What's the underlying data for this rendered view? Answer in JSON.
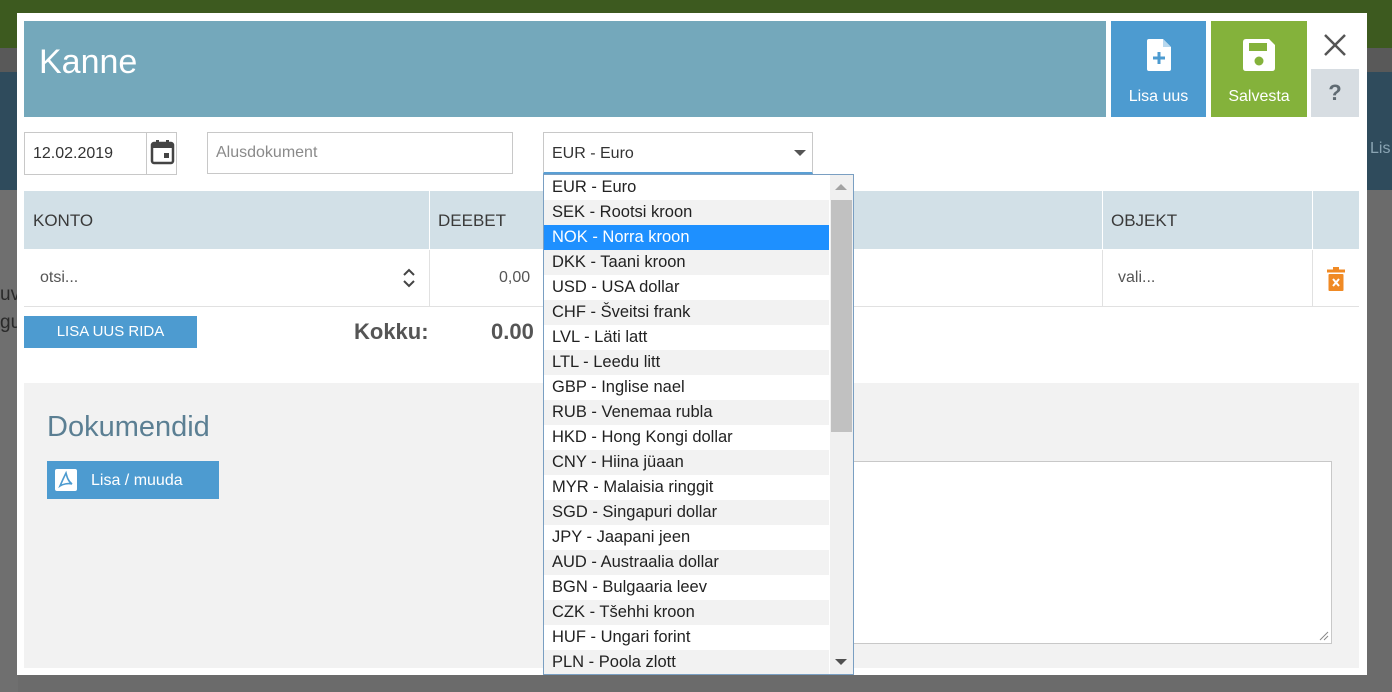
{
  "background": {
    "left_fragment_1": "uv",
    "left_fragment_2": "gu",
    "right_fragment": "Lis"
  },
  "modal": {
    "title": "Kanne",
    "new_button_label": "Lisa uus",
    "save_button_label": "Salvesta",
    "help_button_label": "?",
    "icons": {
      "new": "file-plus-icon",
      "save": "floppy-disk-icon",
      "close": "close-icon",
      "calendar": "calendar-icon",
      "delete": "trash-icon",
      "pdf": "pdf-icon",
      "sort": "updown-chevron-icon"
    },
    "colors": {
      "header": "#74a8bb",
      "new_button": "#4d9bd0",
      "save_button": "#84b23b",
      "delete_icon": "#f08a24",
      "selected_option": "#1e90ff"
    }
  },
  "form": {
    "date_value": "12.02.2019",
    "alusdokument_placeholder": "Alusdokument",
    "currency_value": "EUR - Euro"
  },
  "table": {
    "columns": {
      "konto": "KONTO",
      "deebet": "DEEBET",
      "objekt": "OBJEKT"
    },
    "row": {
      "konto_placeholder": "otsi...",
      "deebet_value": "0,00",
      "objekt_placeholder": "vali..."
    }
  },
  "footer": {
    "add_row_label": "LISA UUS RIDA",
    "kokku_label": "Kokku:",
    "kokku_value": "0.00"
  },
  "documents": {
    "title": "Dokumendid",
    "add_button_label": "Lisa / muuda"
  },
  "currency_dropdown": {
    "selected_index": 2,
    "options": [
      "EUR - Euro",
      "SEK - Rootsi kroon",
      "NOK - Norra kroon",
      "DKK - Taani kroon",
      "USD - USA dollar",
      "CHF - Šveitsi frank",
      "LVL - Läti latt",
      "LTL - Leedu litt",
      "GBP - Inglise nael",
      "RUB - Venemaa rubla",
      "HKD - Hong Kongi dollar",
      "CNY - Hiina jüaan",
      "MYR - Malaisia ringgit",
      "SGD - Singapuri dollar",
      "JPY - Jaapani jeen",
      "AUD - Austraalia dollar",
      "BGN - Bulgaaria leev",
      "CZK - Tšehhi kroon",
      "HUF - Ungari forint",
      "PLN - Poola zlott"
    ]
  }
}
